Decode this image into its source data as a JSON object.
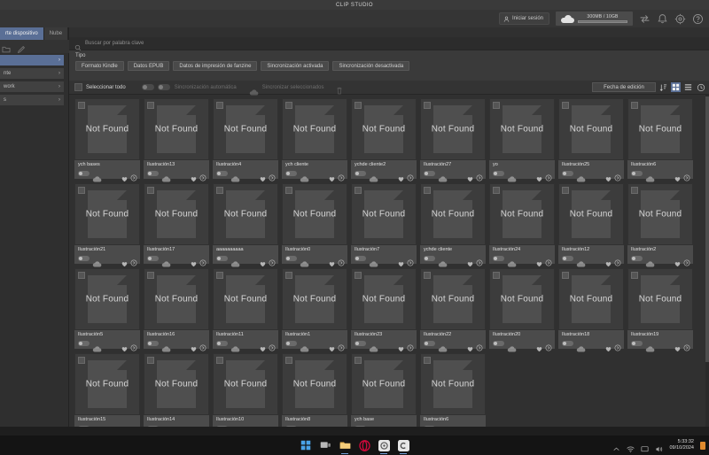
{
  "window": {
    "title": "CLIP STUDIO"
  },
  "topbar": {
    "signin_label": "Iniciar sesión",
    "signin_icon": "user-icon",
    "cloud_icon": "cloud-icon",
    "quota_text": "300MB / 10GB",
    "quota_percent": 22,
    "icons": [
      {
        "name": "transfer-icon"
      },
      {
        "name": "bell-icon"
      },
      {
        "name": "gear-icon"
      },
      {
        "name": "help-icon"
      }
    ]
  },
  "sidebar": {
    "tabs": [
      {
        "label": "rte dispositivo",
        "active": true
      },
      {
        "label": "Nube",
        "active": false
      }
    ],
    "tools": [
      {
        "name": "folder-icon"
      },
      {
        "name": "pencil-icon"
      }
    ],
    "items": [
      {
        "label": "",
        "selected": true,
        "chevron": "›"
      },
      {
        "label": "nte",
        "selected": false,
        "chevron": "›"
      },
      {
        "label": "work",
        "selected": false,
        "chevron": "›"
      },
      {
        "label": "s",
        "selected": false,
        "chevron": "›"
      }
    ]
  },
  "search": {
    "icon": "search-icon",
    "placeholder": "Buscar por palabra clave"
  },
  "filters": {
    "caption": "Tipo",
    "chips": [
      "Formato Kindle",
      "Datos EPUB",
      "Datos de impresión de fanzine",
      "Sincronización activada",
      "Sincronización desactivada"
    ]
  },
  "actionbar": {
    "select_all_label": "Seleccionar todo",
    "auto_sync_label": "Sincronización automática",
    "sync_selected_label": "Sincronizar seleccionados",
    "delete_icon": "trash-icon",
    "sort_value": "Fecha de edición",
    "sort_icon": "sort-az-icon",
    "view_grid_icon": "grid-view-icon",
    "view_list_icon": "list-view-icon",
    "history_icon": "clock-icon"
  },
  "grid": {
    "placeholder_text": "Not Found",
    "card_icons": {
      "sync_toggle": "toggle-icon",
      "cloud": "cloud-icon",
      "favorite": "heart-icon",
      "open": "chevron-right-circle-icon"
    },
    "items": [
      {
        "name": "ych bases"
      },
      {
        "name": "Ilustración13"
      },
      {
        "name": "Ilustración4"
      },
      {
        "name": "ych cliente"
      },
      {
        "name": "ychde cliente2"
      },
      {
        "name": "Ilustración27"
      },
      {
        "name": "yo"
      },
      {
        "name": "Ilustración25"
      },
      {
        "name": "Ilustración6"
      },
      {
        "name": "Ilustración21"
      },
      {
        "name": "Ilustración17"
      },
      {
        "name": "aaaaaaaaaa"
      },
      {
        "name": "Ilustración0"
      },
      {
        "name": "Ilustración7"
      },
      {
        "name": "ychde cliente"
      },
      {
        "name": "Ilustración24"
      },
      {
        "name": "Ilustración12"
      },
      {
        "name": "Ilustración2"
      },
      {
        "name": "Ilustración5"
      },
      {
        "name": "Ilustración16"
      },
      {
        "name": "Ilustración11"
      },
      {
        "name": "Ilustración1"
      },
      {
        "name": "Ilustración23"
      },
      {
        "name": "Ilustración22"
      },
      {
        "name": "Ilustración20"
      },
      {
        "name": "Ilustración18"
      },
      {
        "name": "Ilustración19"
      },
      {
        "name": "Ilustración15"
      },
      {
        "name": "Ilustración14"
      },
      {
        "name": "Ilustración10"
      },
      {
        "name": "Ilustración8"
      },
      {
        "name": "ych base"
      },
      {
        "name": "Ilustración6"
      }
    ]
  },
  "taskbar": {
    "items": [
      {
        "name": "start-button-icon"
      },
      {
        "name": "task-view-icon"
      },
      {
        "name": "file-explorer-icon"
      },
      {
        "name": "opera-icon"
      },
      {
        "name": "clip-studio-paint-icon"
      },
      {
        "name": "clip-studio-icon"
      }
    ],
    "tray": [
      {
        "name": "chevron-up-icon"
      },
      {
        "name": "network-icon"
      },
      {
        "name": "display-icon"
      },
      {
        "name": "volume-icon"
      }
    ],
    "time": "5:33:32",
    "date": "09/10/2024",
    "battery_icon": "battery-icon"
  }
}
